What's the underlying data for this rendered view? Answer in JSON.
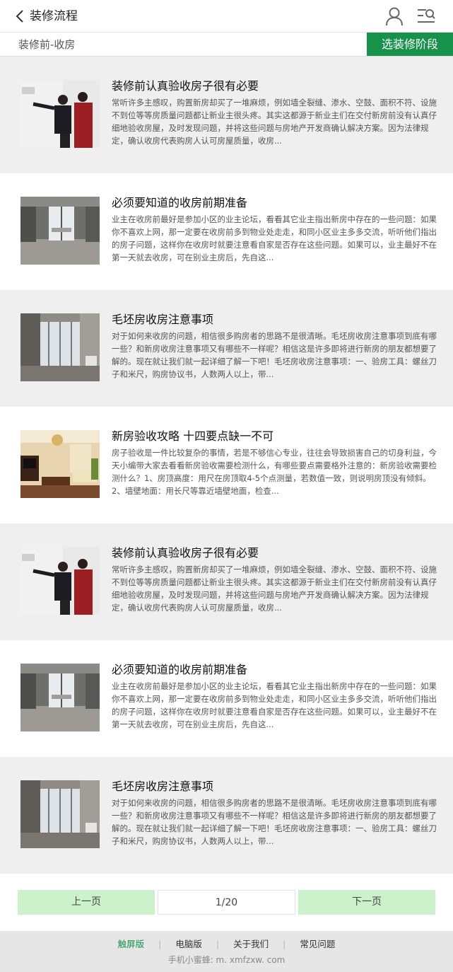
{
  "header": {
    "title": "装修流程",
    "back_icon": "chevron-left-icon",
    "user_icon": "user-icon",
    "list_icon": "search-list-icon"
  },
  "stage": {
    "current": "装修前-收房",
    "select_label": "选装修阶段",
    "accent": "#17924a"
  },
  "articles": [
    {
      "title": "装修前认真验收房子很有必要",
      "summary": "常听许多主感叹，购置新房却买了一堆麻烦，例如墙全裂缝、渗水、空鼓、面积不符、设施不到位等等房质量问题都让新业主很头疼。其实这都源于新业主们在交付新房前没有认真仔细地验收房屋，及时发现问题，并将这些问题与房地产开发商确认解决方案。因为法律规定，确认收房代表购房人认可房屋质量，收房...",
      "image": "couple-inspecting-wall"
    },
    {
      "title": "必须要知道的收房前期准备",
      "summary": "业主在收房前最好是参加小区的业主论坛，看看其它业主指出新房中存在的一些问题：如果你不喜欢上网，那一定要在收房前多到物业处走走，和同小区业主多多交流，听听他们指出的房子问题，这样你在收房时就要注意看自家是否存在这些问题。如果可以，业主最好不在第一天就去收房，可在别业主房后，先自这...",
      "image": "empty-concrete-room"
    },
    {
      "title": "毛坯房收房注意事项",
      "summary": "对于如何来收房的问题，相信很多购房者的思路不是很清晰。毛坯房收房注意事项到底有哪一些？和新房收房注意事项又有哪些不一样呢？相信这是许多即将进行新房的朋友都想要了解的。现在就让我们就一起详细了解一下吧！毛坯房收房注意事项：一、验房工具：螺丝刀子和米尺，购房协议书，人数两人以上，带...",
      "image": "unfinished-room-window"
    },
    {
      "title": "新房验收攻略 十四要点缺一不可",
      "summary": "房子验收是一件比较复杂的事情，若是不够信心专业，往往会导致损害自己的切身利益，今天小编带大家去看看新房验收需要检测什么，有哪些要点需要格外注意的：新房验收需要检测什么？1、房顶高度：用尺在房顶取4-5个点测量，若数值一致，则说明房顶没有倾斜。2、墙壁地面：用长尺等靠近墙壁地面，检查...",
      "image": "furnished-living-room"
    },
    {
      "title": "装修前认真验收房子很有必要",
      "summary": "常听许多主感叹，购置新房却买了一堆麻烦，例如墙全裂缝、渗水、空鼓、面积不符、设施不到位等等房质量问题都让新业主很头疼。其实这都源于新业主们在交付新房前没有认真仔细地验收房屋，及时发现问题，并将这些问题与房地产开发商确认解决方案。因为法律规定，确认收房代表购房人认可房屋质量，收房...",
      "image": "couple-inspecting-wall"
    },
    {
      "title": "必须要知道的收房前期准备",
      "summary": "业主在收房前最好是参加小区的业主论坛，看看其它业主指出新房中存在的一些问题：如果你不喜欢上网，那一定要在收房前多到物业处走走，和同小区业主多多交流，听听他们指出的房子问题，这样你在收房时就要注意看自家是否存在这些问题。如果可以，业主最好不在第一天就去收房，可在别业主房后，先自这...",
      "image": "empty-concrete-room"
    },
    {
      "title": "毛坯房收房注意事项",
      "summary": "对于如何来收房的问题，相信很多购房者的思路不是很清晰。毛坯房收房注意事项到底有哪一些？和新房收房注意事项又有哪些不一样呢？相信这是许多即将进行新房的朋友都想要了解的。现在就让我们就一起详细了解一下吧！毛坯房收房注意事项：一、验房工具：螺丝刀子和米尺，购房协议书，人数两人以上，带...",
      "image": "unfinished-room-window"
    }
  ],
  "pagination": {
    "prev_label": "上一页",
    "page_indicator": "1/20",
    "next_label": "下一页"
  },
  "footer": {
    "links": [
      "触屏版",
      "电脑版",
      "关于我们",
      "常见问题"
    ],
    "active_link": "触屏版",
    "site_text": "手机小蜜蜂: m. xmfzxw. com"
  }
}
